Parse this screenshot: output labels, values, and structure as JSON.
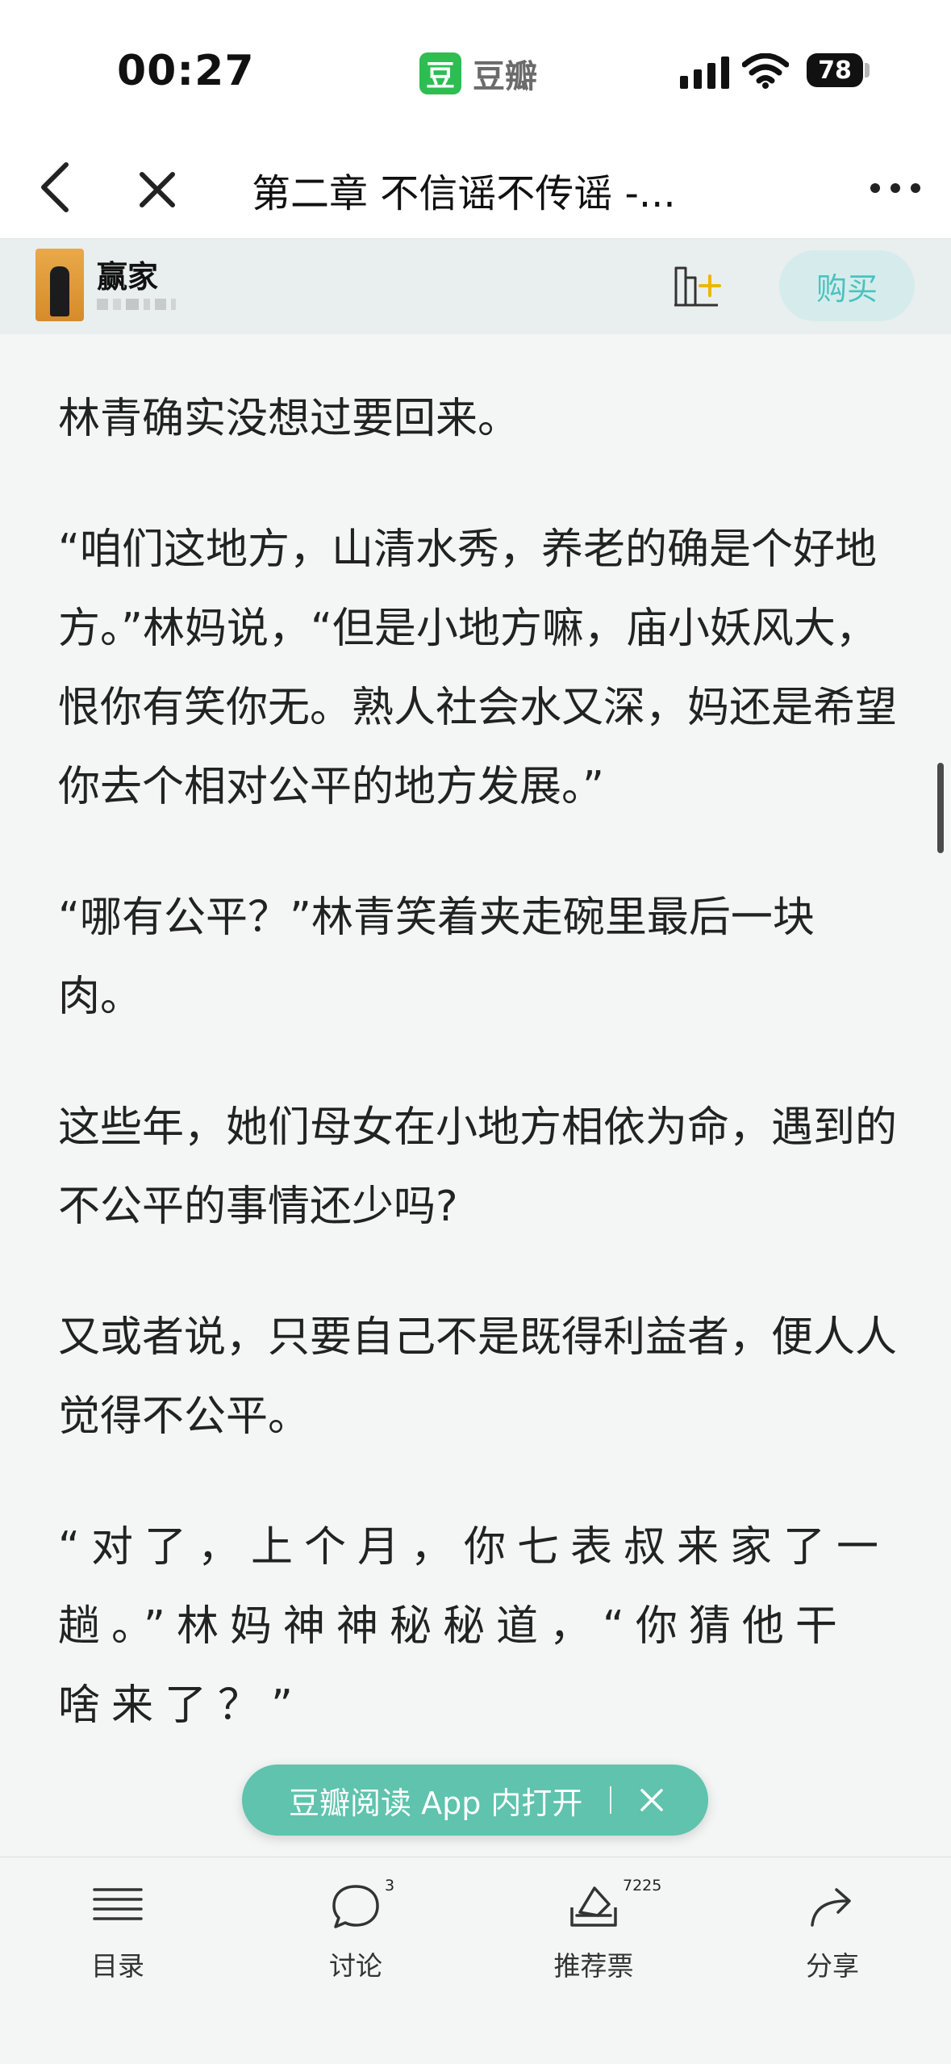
{
  "status_bar": {
    "time": "00:27",
    "app_logo_char": "豆",
    "app_name": "豆瓣",
    "battery": "78"
  },
  "nav": {
    "title": "第二章 不信谣不传谣 -..."
  },
  "book": {
    "title": "赢家",
    "buy_label": "购买"
  },
  "content": {
    "paragraphs": [
      "林青确实没想过要回来。",
      "“咱们这地方，山清水秀，养老的确是个好地方。”林妈说，“但是小地方嘛，庙小妖风大，恨你有笑你无。熟人社会水又深，妈还是希望你去个相对公平的地方发展。”",
      "“哪有公平？”林青笑着夹走碗里最后一块肉。",
      "这些年，她们母女在小地方相依为命，遇到的不公平的事情还少吗?",
      "又或者说，只要自己不是既得利益者，便人人觉得不公平。",
      "“对了，上个月，你七表叔来家了一趟。”林妈神神秘秘道，“你猜他干啥来了？”"
    ]
  },
  "toast": {
    "text": "豆瓣阅读 App 内打开"
  },
  "tabs": [
    {
      "label": "目录",
      "icon": "list-icon",
      "badge": ""
    },
    {
      "label": "讨论",
      "icon": "chat-bubble-icon",
      "badge": "3"
    },
    {
      "label": "推荐票",
      "icon": "ticket-icon",
      "badge": "7225"
    },
    {
      "label": "分享",
      "icon": "share-arrow-icon",
      "badge": ""
    }
  ],
  "colors": {
    "accent": "#5fc3ad",
    "buy_text": "#4cc2bf",
    "background": "#f4f6f6"
  }
}
